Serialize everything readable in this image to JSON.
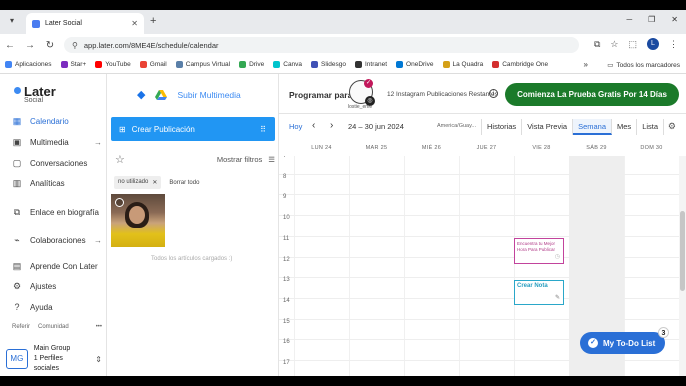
{
  "browser": {
    "tab_title": "Later Social",
    "url": "app.later.com/8ME4E/schedule/calendar",
    "profile_initial": "L",
    "bookmarks": [
      {
        "label": "Aplicaciones",
        "color": "#4285f4"
      },
      {
        "label": "Star+",
        "color": "#7b2cbf"
      },
      {
        "label": "YouTube",
        "color": "#ff0000"
      },
      {
        "label": "Gmail",
        "color": "#ea4335"
      },
      {
        "label": "Campus Virtual",
        "color": "#5a7fa8"
      },
      {
        "label": "Drive",
        "color": "#34a853"
      },
      {
        "label": "Canva",
        "color": "#00c4cc"
      },
      {
        "label": "Slidesgo",
        "color": "#3f51b5"
      },
      {
        "label": "Intranet",
        "color": "#333333"
      },
      {
        "label": "OneDrive",
        "color": "#0078d4"
      },
      {
        "label": "La Quadra",
        "color": "#d4a017"
      },
      {
        "label": "Cambridge One",
        "color": "#d32f2f"
      }
    ],
    "all_bookmarks": "Todos los marcadores"
  },
  "sidebar": {
    "logo": "Later",
    "logo_sub": "Social",
    "items": [
      {
        "label": "Calendario",
        "icon": "calendar-icon",
        "glyph": "▦"
      },
      {
        "label": "Multimedia",
        "icon": "media-icon",
        "glyph": "▣"
      },
      {
        "label": "Conversaciones",
        "icon": "chat-icon",
        "glyph": "▢"
      },
      {
        "label": "Analíticas",
        "icon": "chart-icon",
        "glyph": "▥"
      },
      {
        "label": "Enlace en biografía",
        "icon": "link-icon",
        "glyph": "⧉"
      },
      {
        "label": "Colaboraciones",
        "icon": "collab-icon",
        "glyph": "⌁"
      },
      {
        "label": "Aprende Con Later",
        "icon": "book-icon",
        "glyph": "▤"
      },
      {
        "label": "Ajustes",
        "icon": "settings-icon",
        "glyph": "⚙"
      },
      {
        "label": "Ayuda",
        "icon": "help-icon",
        "glyph": "?"
      }
    ],
    "footer_links": [
      "Referir",
      "Comunidad"
    ],
    "group": {
      "initials": "MG",
      "name": "Main Group",
      "sub": "1 Perfiles sociales"
    }
  },
  "media": {
    "upload_label": "Subir Multimedia",
    "create_post": "Crear Publicación",
    "show_filters": "Mostrar filtros",
    "chip": "no utilizado",
    "clear_all": "Borrar todo",
    "end_note": "Todos los artículos cargados :)"
  },
  "calendar": {
    "program_for": "Programar para",
    "profile_name": "lostie_eme",
    "remaining": "12 Instagram Publicaciones Restantes",
    "trial_button": "Comienza La Prueba Gratis Por 14 Días",
    "today": "Hoy",
    "range": "24 – 30 jun 2024",
    "timezone": "America/Guay...",
    "views": [
      "Historias",
      "Vista Previa",
      "Semana",
      "Mes",
      "Lista"
    ],
    "selected_view": "Semana",
    "days": [
      "LUN 24",
      "MAR 25",
      "MIÉ 26",
      "JUE 27",
      "VIE 28",
      "SÁB 29",
      "DOM 30"
    ],
    "hours": [
      "7",
      "8",
      "9",
      "10",
      "11",
      "12",
      "13",
      "14",
      "15",
      "16",
      "17"
    ],
    "event1": "Encuentra tu Mejor Hora Para Publicar",
    "event2": "Crear Nota",
    "todo_label": "My To-Do List",
    "todo_count": "3"
  }
}
